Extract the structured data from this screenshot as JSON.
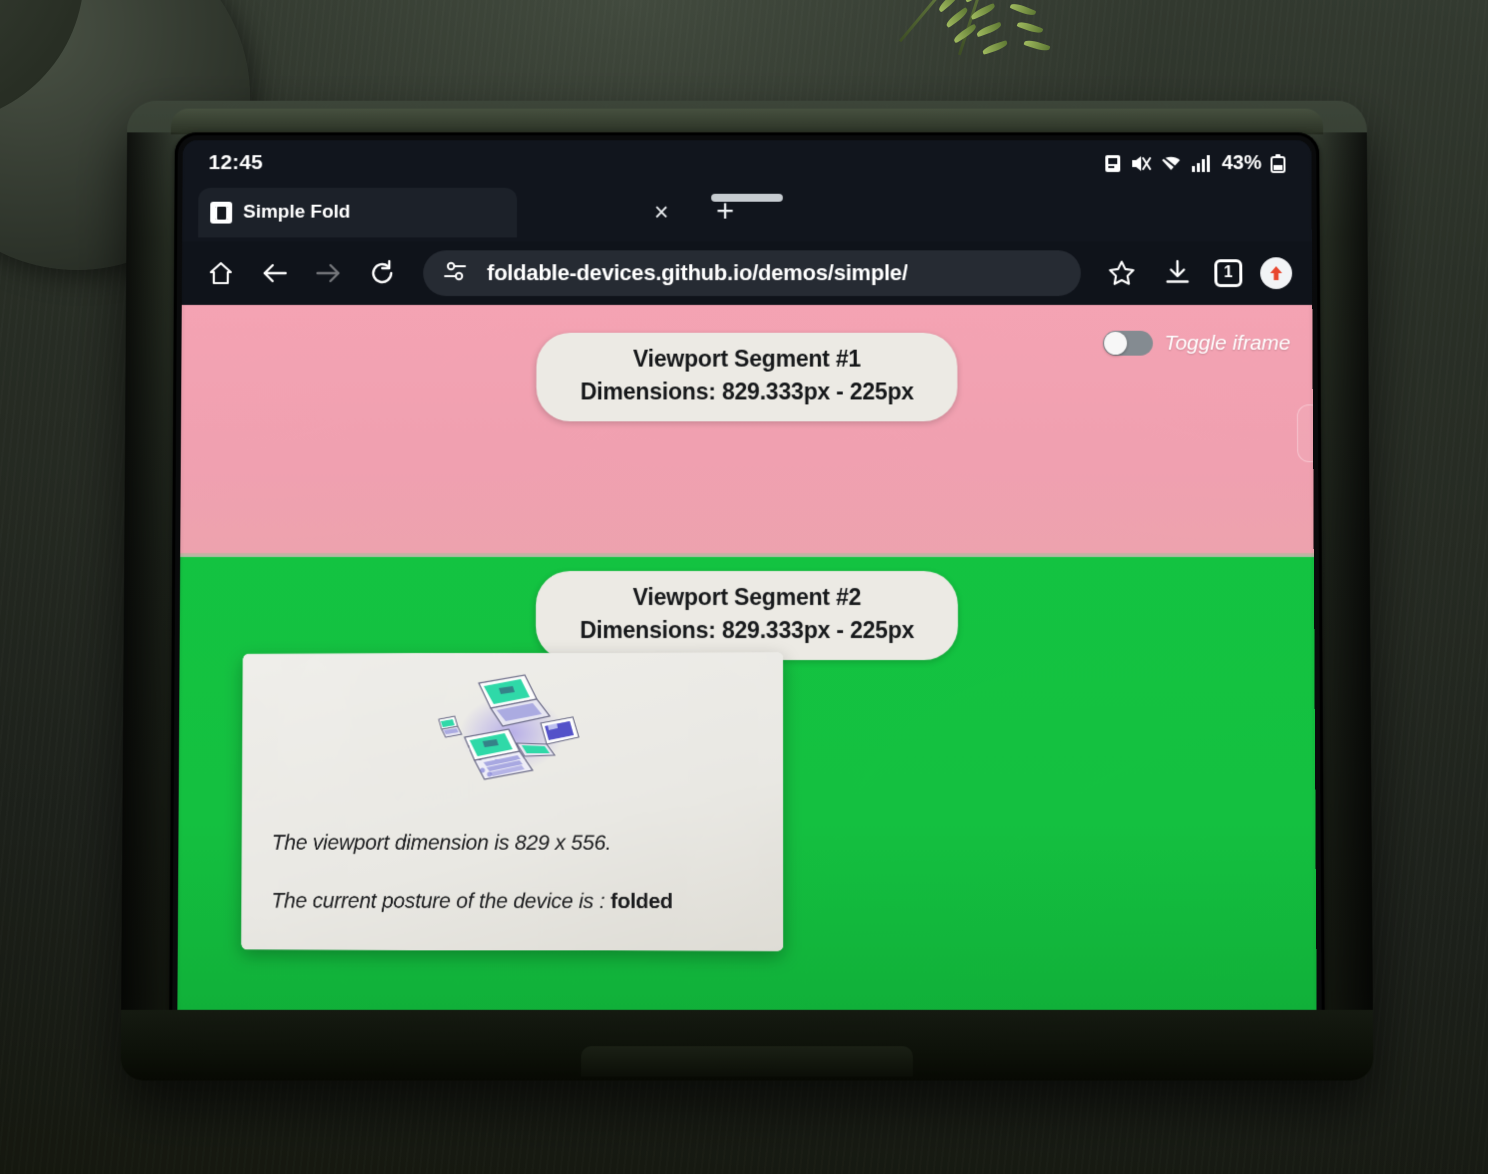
{
  "status_bar": {
    "clock": "12:45",
    "battery_percent": "43%",
    "icons": [
      "screenshot-icon",
      "mute-icon",
      "wifi-icon",
      "signal-icon",
      "battery-icon"
    ]
  },
  "browser": {
    "tab": {
      "title": "Simple Fold",
      "favicon": "simple-fold-favicon",
      "close_label": "×"
    },
    "new_tab_label": "+",
    "toolbar": {
      "home_icon": "home-icon",
      "back_icon": "back-arrow-icon",
      "forward_icon": "forward-arrow-icon",
      "reload_icon": "reload-icon",
      "site_settings_icon": "tune-icon",
      "url": "foldable-devices.github.io/demos/simple/",
      "bookmark_icon": "star-icon",
      "download_icon": "download-icon",
      "tab_count": "1",
      "profile_icon": "profile-update-icon"
    }
  },
  "page": {
    "colors": {
      "segment1_bg": "#f2a1b1",
      "segment2_bg": "#13c341",
      "card_bg": "#ecebe6",
      "toggle_track": "#848b91"
    },
    "segments": [
      {
        "title": "Viewport Segment #1",
        "dimensions": "Dimensions: 829.333px - 225px"
      },
      {
        "title": "Viewport Segment #2",
        "dimensions": "Dimensions: 829.333px - 225px"
      }
    ],
    "toggle": {
      "label": "Toggle iframe",
      "state": "off"
    },
    "info_card": {
      "illustration": "foldable-devices-illustration",
      "viewport_line": "The viewport dimension is 829 x 556.",
      "posture_prefix": "The current posture of the device is : ",
      "posture_value": "folded"
    }
  },
  "system_nav": {
    "gesture_bar": "home-gesture-bar"
  }
}
